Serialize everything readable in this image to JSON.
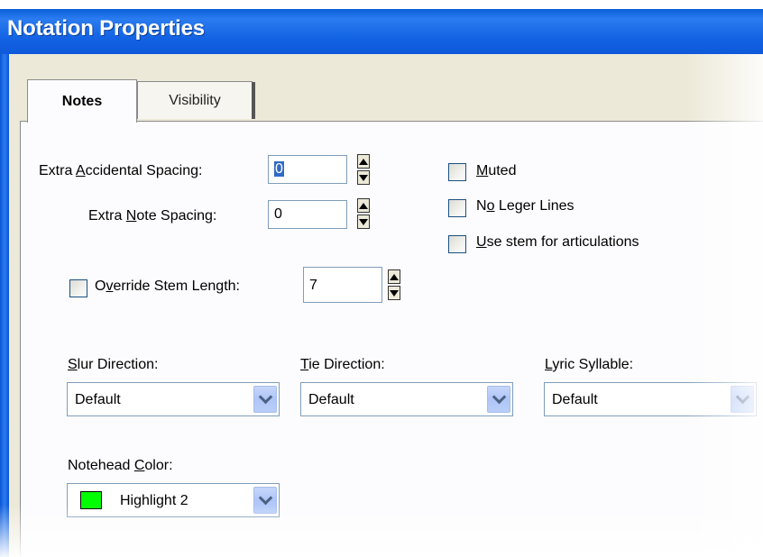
{
  "window": {
    "title": "Notation Properties"
  },
  "tabs": [
    {
      "label": "Notes",
      "active": true
    },
    {
      "label": "Visibility",
      "active": false
    }
  ],
  "fields": {
    "extra_accidental_spacing": {
      "label_pre": "Extra ",
      "label_key": "A",
      "label_post": "ccidental Spacing:",
      "value": "0"
    },
    "extra_note_spacing": {
      "label_pre": "Extra ",
      "label_key": "N",
      "label_post": "ote Spacing:",
      "value": "0"
    },
    "override_stem_length": {
      "label_pre": "O",
      "label_key": "v",
      "label_post": "erride Stem Length:",
      "value": "7",
      "checked": false
    }
  },
  "checkboxes": {
    "muted": {
      "label_key": "M",
      "label_post": "uted",
      "checked": false
    },
    "no_leger_lines": {
      "label_pre": "N",
      "label_key": "o",
      "label_post": " Leger Lines",
      "checked": false
    },
    "use_stem": {
      "label_key": "U",
      "label_post": "se stem for articulations",
      "checked": false
    }
  },
  "dropdowns": {
    "slur_direction": {
      "label_key": "S",
      "label_post": "lur Direction:",
      "value": "Default"
    },
    "tie_direction": {
      "label_key": "T",
      "label_post": "ie Direction:",
      "value": "Default"
    },
    "lyric_syllable": {
      "label_key": "L",
      "label_post": "yric Syllable:",
      "value": "Default"
    },
    "notehead_color": {
      "label_pre": "Notehead ",
      "label_key": "C",
      "label_post": "olor:",
      "value": "Highlight 2",
      "swatch": "#00ff00"
    }
  },
  "colors": {
    "titlebar": "#0b55d4",
    "dialog_bg": "#ece9d8",
    "selection": "#316ac5"
  },
  "icons": {
    "spinner_up": "triangle-up",
    "spinner_down": "triangle-down",
    "dropdown": "chevron-down"
  }
}
